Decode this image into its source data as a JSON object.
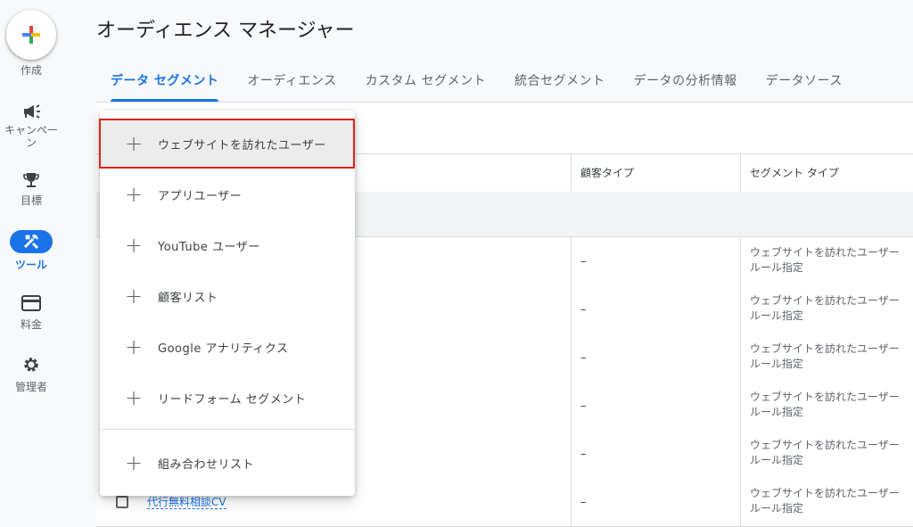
{
  "rail": {
    "create_label": "作成",
    "campaign_label": "キャンペーン",
    "goals_label": "目標",
    "tools_label": "ツール",
    "billing_label": "料金",
    "admin_label": "管理者"
  },
  "header": {
    "title": "オーディエンス マネージャー"
  },
  "tabs": [
    {
      "label": "データ セグメント",
      "active": true
    },
    {
      "label": "オーディエンス"
    },
    {
      "label": "カスタム セグメント"
    },
    {
      "label": "統合セグメント"
    },
    {
      "label": "データの分析情報"
    },
    {
      "label": "データソース"
    }
  ],
  "table": {
    "columns": [
      "顧客タイプ",
      "セグメント タイプ"
    ],
    "rows": [
      {
        "customer_type": "–",
        "seg_type": "ウェブサイトを訪れたユーザー",
        "seg_sub": "ルール指定"
      },
      {
        "customer_type": "–",
        "seg_type": "ウェブサイトを訪れたユーザー",
        "seg_sub": "ルール指定"
      },
      {
        "customer_type": "–",
        "seg_type": "ウェブサイトを訪れたユーザー",
        "seg_sub": "ルール指定"
      },
      {
        "customer_type": "–",
        "seg_type": "ウェブサイトを訪れたユーザー",
        "seg_sub": "ルール指定"
      },
      {
        "customer_type": "–",
        "seg_type": "ウェブサイトを訪れたユーザー",
        "seg_sub": "ルール指定"
      },
      {
        "name": "代行無料相談CV",
        "customer_type": "–",
        "seg_type": "ウェブサイトを訪れたユーザー",
        "seg_sub": "ルール指定"
      }
    ]
  },
  "menu": {
    "items": [
      {
        "label": "ウェブサイトを訪れたユーザー",
        "highlighted": true
      },
      {
        "label": "アプリユーザー"
      },
      {
        "label": "YouTube ユーザー"
      },
      {
        "label": "顧客リスト"
      },
      {
        "label": "Google アナリティクス"
      },
      {
        "label": "リードフォーム セグメント"
      },
      {
        "label": "組み合わせリスト"
      }
    ],
    "highlight_color": "#e0221b"
  },
  "colors": {
    "accent": "#1a73e8"
  }
}
